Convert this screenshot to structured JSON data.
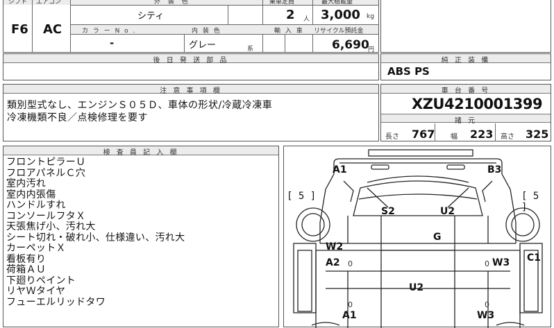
{
  "top": {
    "head_shift": "シフト",
    "head_aircon": "エアコン",
    "head_exterior": "外 装 色",
    "head_capacity": "乗車定員",
    "head_max_load": "最大積載量",
    "shift": "F6",
    "aircon": "AC",
    "exterior_color": "シティ",
    "capacity": "2",
    "capacity_unit": "人",
    "max_load": "3,000",
    "max_load_unit": "kg",
    "label_color_no": "カ ラ ー N o .",
    "label_interior": "内 装 色",
    "label_import": "輸 入 車",
    "label_recycle": "リサイクル預託金",
    "color_no": "-",
    "interior_color": "グレー",
    "interior_suffix": "系",
    "recycle_fee": "6,690",
    "recycle_unit": "円"
  },
  "later_parts": {
    "header": "後 日 発 送 部 品",
    "value": ""
  },
  "genuine_equipment": {
    "header": "純 正 装 備",
    "value": "ABS PS"
  },
  "notes": {
    "header": "注 意 事 項 欄",
    "lines": [
      "類別型式なし、エンジンＳ０５Ｄ、車体の形状/冷蔵冷凍車",
      "冷凍機類不良／点検修理を要す"
    ]
  },
  "chassis": {
    "header": "車 台 番 号",
    "number": "XZU4210001399",
    "dims_header": "諸 元",
    "length_label": "長さ",
    "length": "767",
    "width_label": "幅",
    "width": "223",
    "height_label": "高さ",
    "height": "325"
  },
  "inspector": {
    "header": "検 査 員 記 入 欄",
    "lines": [
      "フロントピラーＵ",
      "フロアパネルＣ穴",
      "室内汚れ",
      "室内内張傷",
      "ハンドルすれ",
      "コンソールフタＸ",
      "天張焦げ小、汚れ大",
      "シート切れ・破れ小、仕様違い、汚れ大",
      "カーペットＸ",
      "看板有り",
      "荷箱ＡＵ",
      "下廻りペイント",
      "リヤＷタイヤ",
      "フューエルリッドタワ"
    ]
  },
  "diagram": {
    "marks": {
      "front_left": "A1",
      "front_right": "B3",
      "seat_left": "S2",
      "seat_right": "U2",
      "center": "G",
      "side_left_upper": "W2",
      "side_left_lower": "A2",
      "side_right_lower": "W3",
      "rear_right_outer": "C1",
      "bed_center": "U2",
      "bottom_left": "A1",
      "bottom_right": "W3",
      "tyre_left": "[ 5 ]",
      "tyre_right": "[ 5 ]",
      "zero_left": "0",
      "zero_right": "0",
      "zero_bl": "0",
      "zero_br": "0"
    }
  }
}
